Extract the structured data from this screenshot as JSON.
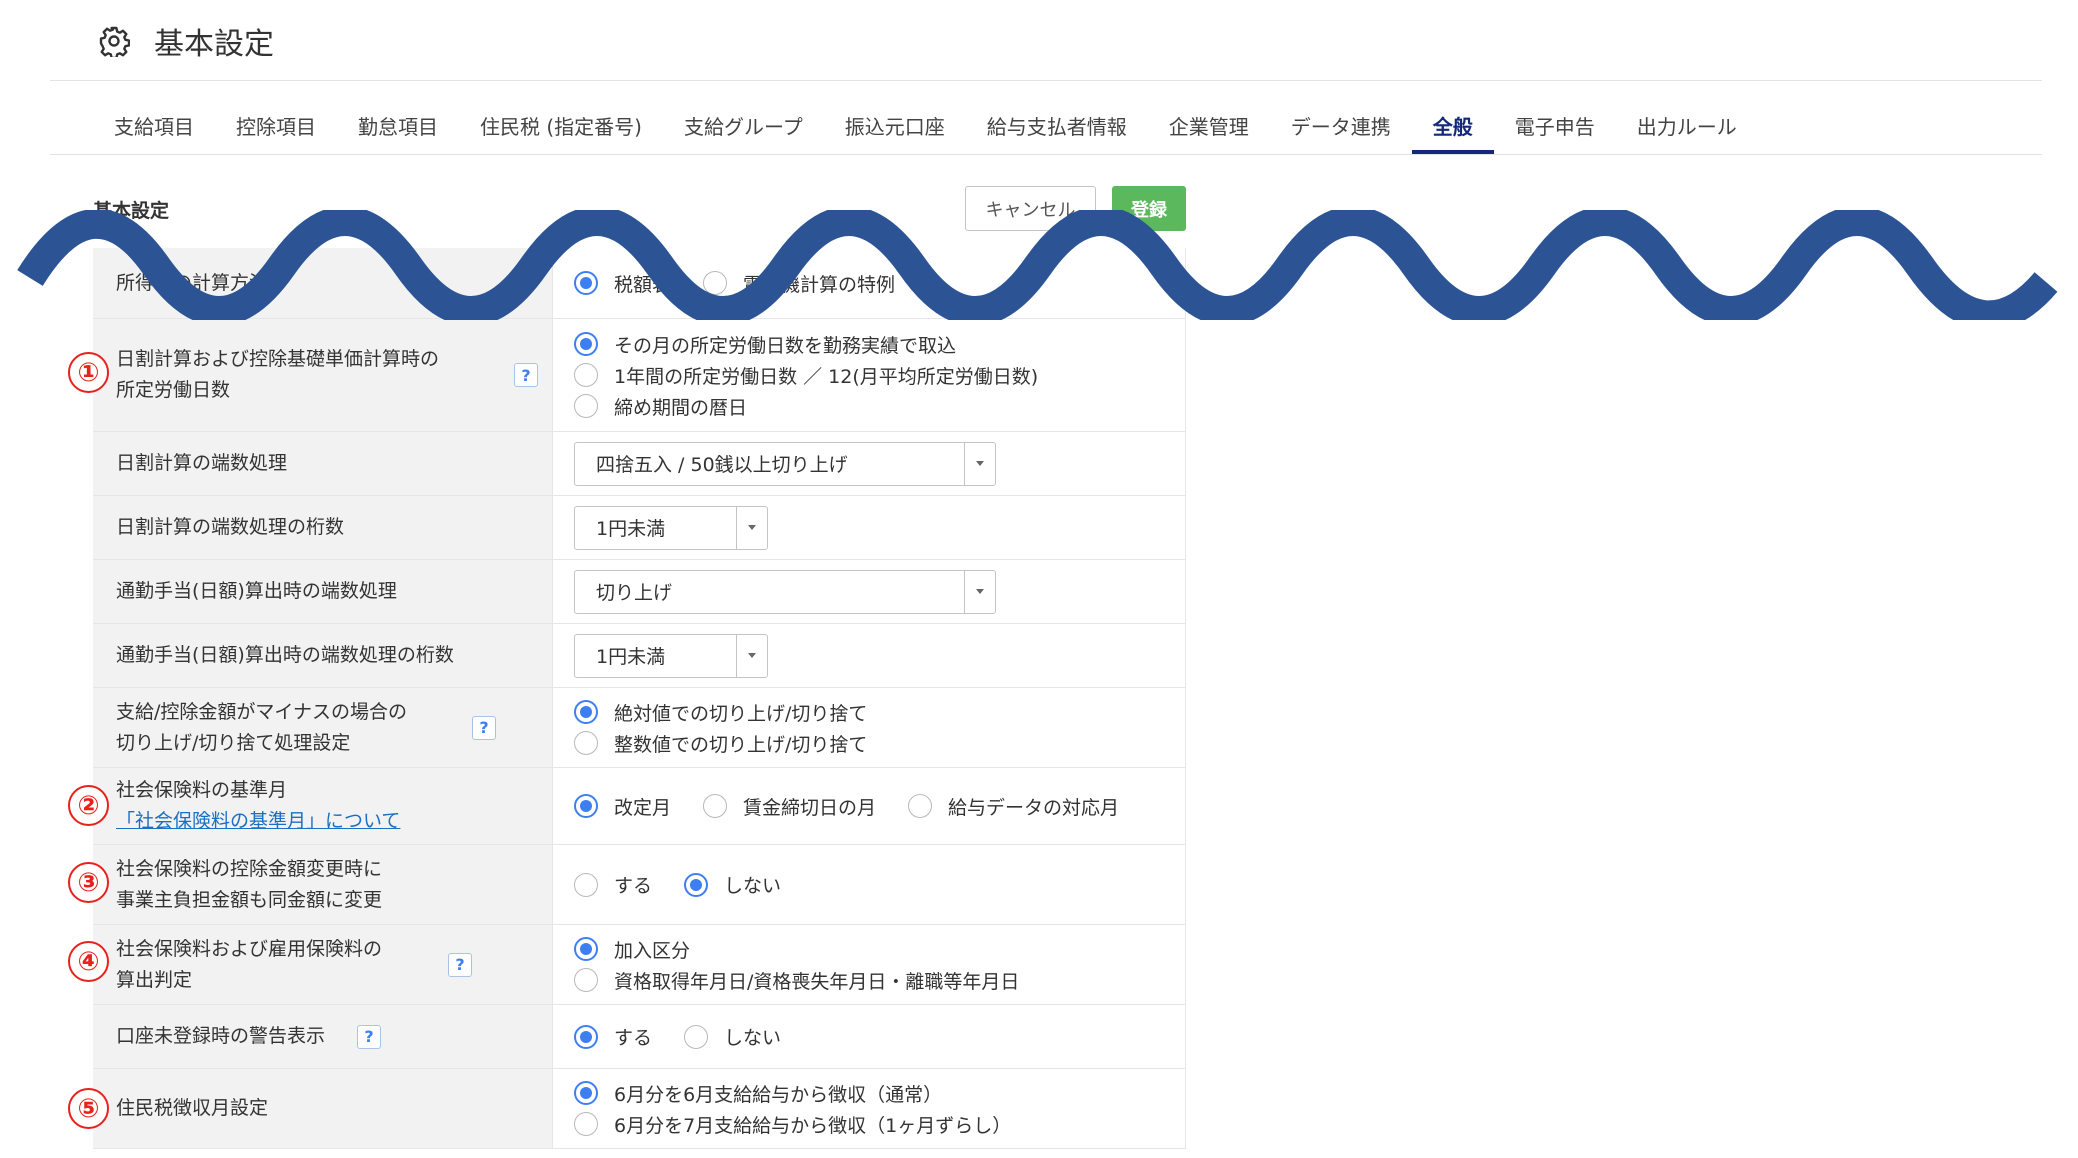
{
  "header": {
    "title": "基本設定",
    "icon": "gear-icon"
  },
  "tabs": [
    {
      "label": "支給項目",
      "active": false
    },
    {
      "label": "控除項目",
      "active": false
    },
    {
      "label": "勤怠項目",
      "active": false
    },
    {
      "label": "住民税 (指定番号)",
      "active": false
    },
    {
      "label": "支給グループ",
      "active": false
    },
    {
      "label": "振込元口座",
      "active": false
    },
    {
      "label": "給与支払者情報",
      "active": false
    },
    {
      "label": "企業管理",
      "active": false
    },
    {
      "label": "データ連携",
      "active": false
    },
    {
      "label": "全般",
      "active": true
    },
    {
      "label": "電子申告",
      "active": false
    },
    {
      "label": "出力ルール",
      "active": false
    }
  ],
  "section": {
    "title": "基本設定",
    "cancel_label": "キャンセル",
    "register_label": "登録"
  },
  "colors": {
    "accent": "#3d7ff0",
    "tab_active": "#13287a",
    "register": "#5cb85c",
    "marker": "#e8211a",
    "wave": "#2c5494"
  },
  "markers": [
    "①",
    "②",
    "③",
    "④",
    "⑤"
  ],
  "rows": [
    {
      "label": [
        "所得税の計算方法"
      ],
      "options": [
        "税額表",
        "電算機計算の特例"
      ]
    },
    {
      "label": [
        "日割計算および控除基礎単価計算時の",
        "所定労働日数"
      ],
      "help": "?",
      "options": [
        "その月の所定労働日数を勤務実績で取込",
        "1年間の所定労働日数 ／ 12(月平均所定労働日数)",
        "締め期間の暦日"
      ]
    },
    {
      "label": [
        "日割計算の端数処理"
      ],
      "select": "四捨五入 / 50銭以上切り上げ"
    },
    {
      "label": [
        "日割計算の端数処理の桁数"
      ],
      "select": "1円未満"
    },
    {
      "label": [
        "通勤手当(日額)算出時の端数処理"
      ],
      "select": "切り上げ"
    },
    {
      "label": [
        "通勤手当(日額)算出時の端数処理の桁数"
      ],
      "select": "1円未満"
    },
    {
      "label": [
        "支給/控除金額がマイナスの場合の",
        "切り上げ/切り捨て処理設定"
      ],
      "help": "?",
      "options": [
        "絶対値での切り上げ/切り捨て",
        "整数値での切り上げ/切り捨て"
      ]
    },
    {
      "label": [
        "社会保険料の基準月"
      ],
      "link": "「社会保険料の基準月」について",
      "options": [
        "改定月",
        "賃金締切日の月",
        "給与データの対応月"
      ]
    },
    {
      "label": [
        "社会保険料の控除金額変更時に",
        "事業主負担金額も同金額に変更"
      ],
      "options": [
        "する",
        "しない"
      ]
    },
    {
      "label": [
        "社会保険料および雇用保険料の",
        "算出判定"
      ],
      "help": "?",
      "options": [
        "加入区分",
        "資格取得年月日/資格喪失年月日・離職等年月日"
      ]
    },
    {
      "label": [
        "口座未登録時の警告表示"
      ],
      "help": "?",
      "options": [
        "する",
        "しない"
      ]
    },
    {
      "label": [
        "住民税徴収月設定"
      ],
      "options": [
        "6月分を6月支給給与から徴収（通常）",
        "6月分を7月支給給与から徴収（1ヶ月ずらし）"
      ]
    }
  ]
}
